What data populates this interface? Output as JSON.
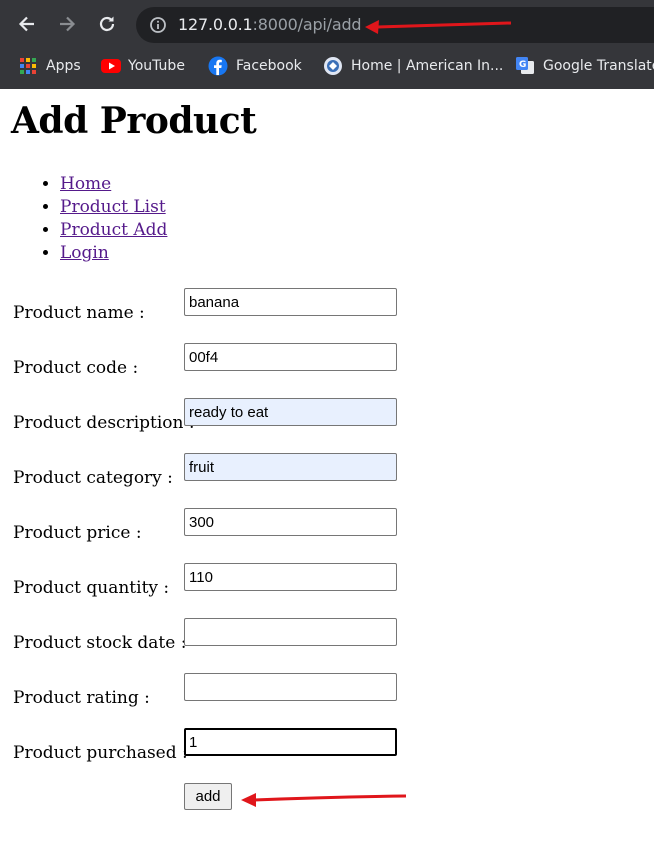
{
  "browser": {
    "url_host": "127.0.0.1",
    "url_path": ":8000/api/add",
    "bookmarks": [
      {
        "label": "Apps",
        "icon": "apps-grid-icon"
      },
      {
        "label": "YouTube",
        "icon": "youtube-icon"
      },
      {
        "label": "Facebook",
        "icon": "facebook-icon"
      },
      {
        "label": "Home | American In...",
        "icon": "site-icon"
      },
      {
        "label": "Google Translate",
        "icon": "google-translate-icon"
      }
    ]
  },
  "page": {
    "title": "Add Product",
    "nav": [
      "Home",
      "Product List",
      "Product Add",
      "Login"
    ],
    "fields": [
      {
        "label": "Product name :",
        "value": "banana"
      },
      {
        "label": "Product code :",
        "value": "00f4"
      },
      {
        "label": "Product description :",
        "value": "ready to eat"
      },
      {
        "label": "Product category :",
        "value": "fruit"
      },
      {
        "label": "Product price :",
        "value": "300"
      },
      {
        "label": "Product quantity :",
        "value": "110"
      },
      {
        "label": "Product stock date :",
        "value": ""
      },
      {
        "label": "Product rating :",
        "value": ""
      },
      {
        "label": "Product purchased :",
        "value": "1"
      }
    ],
    "submit_label": "add"
  },
  "colors": {
    "chrome_bg": "#35363a",
    "omnibox_bg": "#202124",
    "link": "#551a8b",
    "autofill_bg": "#e8f0fe",
    "annotation_arrow": "#e0161b"
  }
}
